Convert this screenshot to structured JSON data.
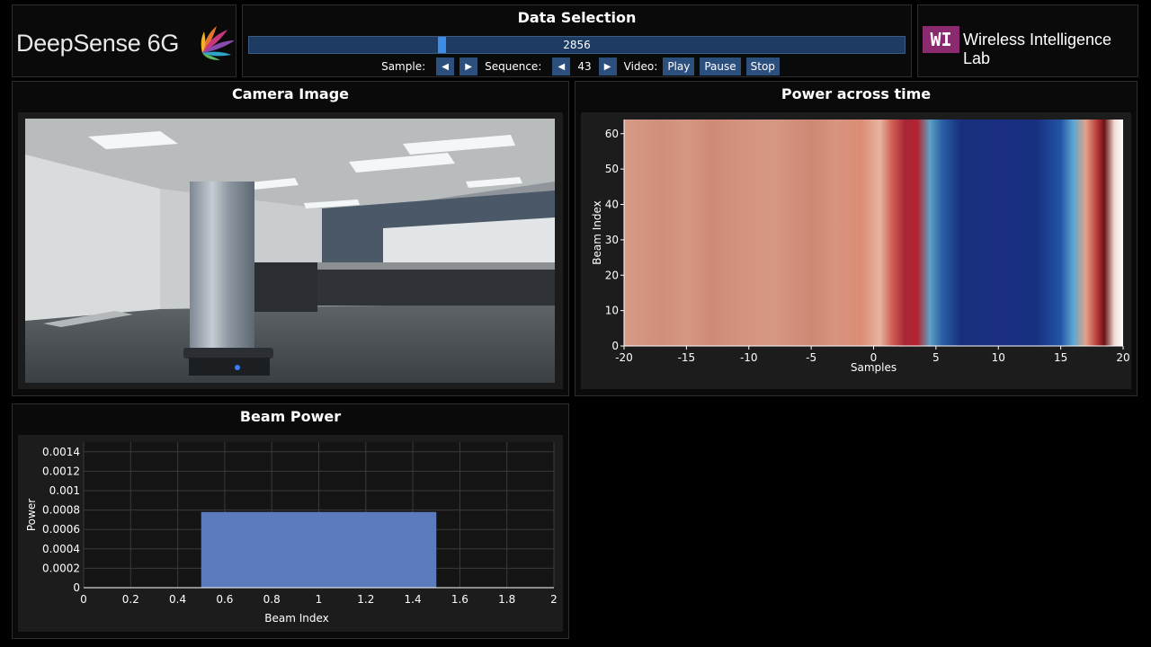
{
  "brand": {
    "name": "DeepSense 6G"
  },
  "data_selection": {
    "title": "Data Selection",
    "slider_value": "2856",
    "slider_fraction": 0.292,
    "sample_label": "Sample:",
    "sequence_label": "Sequence:",
    "sequence_value": "43",
    "video_label": "Video:",
    "play_label": "Play",
    "pause_label": "Pause",
    "stop_label": "Stop"
  },
  "lab": {
    "icon_text": "WI",
    "name": "Wireless Intelligence Lab"
  },
  "camera": {
    "title": "Camera Image"
  },
  "power_across_time": {
    "title": "Power across time",
    "chart_data": {
      "type": "heatmap",
      "xlabel": "Samples",
      "ylabel": "Beam Index",
      "xlim": [
        -20,
        20
      ],
      "ylim": [
        0,
        64
      ],
      "x_ticks": [
        -20,
        -15,
        -10,
        -5,
        0,
        5,
        10,
        15,
        20
      ],
      "y_ticks": [
        0,
        10,
        20,
        30,
        40,
        50,
        60
      ],
      "column_colors": [
        {
          "x": -20,
          "color": "#d89a88"
        },
        {
          "x": -17,
          "color": "#d08e7c"
        },
        {
          "x": -15,
          "color": "#d69784"
        },
        {
          "x": -13,
          "color": "#ce8a77"
        },
        {
          "x": -10,
          "color": "#d59482"
        },
        {
          "x": -8,
          "color": "#d69784"
        },
        {
          "x": -5,
          "color": "#cd8874"
        },
        {
          "x": -3,
          "color": "#d7947f"
        },
        {
          "x": -1,
          "color": "#dc8c74"
        },
        {
          "x": 0.5,
          "color": "#e6b4a2"
        },
        {
          "x": 1.5,
          "color": "#cf5e52"
        },
        {
          "x": 2.5,
          "color": "#a82636"
        },
        {
          "x": 3.5,
          "color": "#b3242f"
        },
        {
          "x": 4.5,
          "color": "#5fa0c4"
        },
        {
          "x": 5.5,
          "color": "#2a5fa6"
        },
        {
          "x": 7,
          "color": "#182f7c"
        },
        {
          "x": 10,
          "color": "#1a2f83"
        },
        {
          "x": 13,
          "color": "#183080"
        },
        {
          "x": 15,
          "color": "#2254a6"
        },
        {
          "x": 16,
          "color": "#5aa6d2"
        },
        {
          "x": 17,
          "color": "#e0a489"
        },
        {
          "x": 18,
          "color": "#b2312f"
        },
        {
          "x": 18.5,
          "color": "#6a1118"
        },
        {
          "x": 19.3,
          "color": "#efdcd4"
        },
        {
          "x": 20,
          "color": "#ffffff"
        }
      ]
    }
  },
  "beam_power": {
    "title": "Beam Power",
    "chart_data": {
      "type": "bar",
      "x": [
        1
      ],
      "values": [
        0.00078
      ],
      "bar_width": 1,
      "xlabel": "Beam Index",
      "ylabel": "Power",
      "xlim": [
        0,
        2
      ],
      "ylim": [
        0,
        0.0015
      ],
      "x_ticks": [
        "0",
        "0.2",
        "0.4",
        "0.6",
        "0.8",
        "1",
        "1.2",
        "1.4",
        "1.6",
        "1.8",
        "2"
      ],
      "y_ticks": [
        "0",
        "0.0002",
        "0.0004",
        "0.0006",
        "0.0008",
        "0.001",
        "0.0012",
        "0.0014"
      ],
      "bar_color": "#5b7bbd",
      "grid": true
    }
  }
}
